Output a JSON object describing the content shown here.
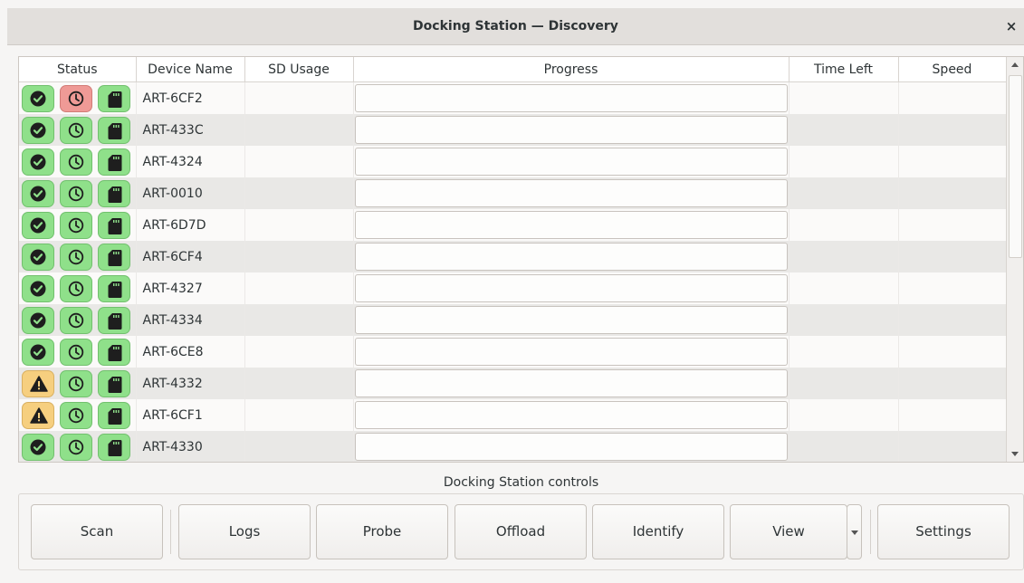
{
  "window": {
    "title": "Docking Station — Discovery",
    "close_label": "×"
  },
  "table": {
    "columns": [
      "Status",
      "Device Name",
      "SD Usage",
      "Progress",
      "Time Left",
      "Speed"
    ],
    "rows": [
      {
        "name": "ART-6CF2",
        "status": [
          "ok-green",
          "clock-red",
          "sd-green"
        ],
        "sd_usage": "",
        "progress": 0,
        "time_left": "",
        "speed": ""
      },
      {
        "name": "ART-433C",
        "status": [
          "ok-green",
          "clock-green",
          "sd-green"
        ],
        "sd_usage": "",
        "progress": 0,
        "time_left": "",
        "speed": ""
      },
      {
        "name": "ART-4324",
        "status": [
          "ok-green",
          "clock-green",
          "sd-green"
        ],
        "sd_usage": "",
        "progress": 0,
        "time_left": "",
        "speed": ""
      },
      {
        "name": "ART-0010",
        "status": [
          "ok-green",
          "clock-green",
          "sd-green"
        ],
        "sd_usage": "",
        "progress": 0,
        "time_left": "",
        "speed": ""
      },
      {
        "name": "ART-6D7D",
        "status": [
          "ok-green",
          "clock-green",
          "sd-green"
        ],
        "sd_usage": "",
        "progress": 0,
        "time_left": "",
        "speed": ""
      },
      {
        "name": "ART-6CF4",
        "status": [
          "ok-green",
          "clock-green",
          "sd-green"
        ],
        "sd_usage": "",
        "progress": 0,
        "time_left": "",
        "speed": ""
      },
      {
        "name": "ART-4327",
        "status": [
          "ok-green",
          "clock-green",
          "sd-green"
        ],
        "sd_usage": "",
        "progress": 0,
        "time_left": "",
        "speed": ""
      },
      {
        "name": "ART-4334",
        "status": [
          "ok-green",
          "clock-green",
          "sd-green"
        ],
        "sd_usage": "",
        "progress": 0,
        "time_left": "",
        "speed": ""
      },
      {
        "name": "ART-6CE8",
        "status": [
          "ok-green",
          "clock-green",
          "sd-green"
        ],
        "sd_usage": "",
        "progress": 0,
        "time_left": "",
        "speed": ""
      },
      {
        "name": "ART-4332",
        "status": [
          "warning-amber",
          "clock-green",
          "sd-green"
        ],
        "sd_usage": "",
        "progress": 0,
        "time_left": "",
        "speed": ""
      },
      {
        "name": "ART-6CF1",
        "status": [
          "warning-amber",
          "clock-green",
          "sd-green"
        ],
        "sd_usage": "",
        "progress": 0,
        "time_left": "",
        "speed": ""
      },
      {
        "name": "ART-4330",
        "status": [
          "ok-green",
          "clock-green",
          "sd-green"
        ],
        "sd_usage": "",
        "progress": 0,
        "time_left": "",
        "speed": ""
      }
    ]
  },
  "controls": {
    "label": "Docking Station controls",
    "buttons": {
      "scan": "Scan",
      "logs": "Logs",
      "probe": "Probe",
      "offload": "Offload",
      "identify": "Identify",
      "view": "View",
      "settings": "Settings"
    }
  },
  "colors": {
    "status_green": "#8fe08a",
    "status_red": "#ef9a96",
    "status_amber": "#f6cf7f"
  }
}
